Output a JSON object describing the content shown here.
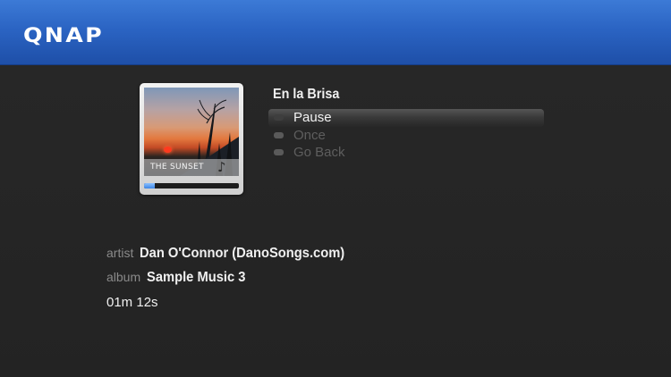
{
  "header": {
    "logo": "QNAP",
    "background_color": "#2b64c3"
  },
  "player": {
    "album_art": {
      "caption": "THE SUNSET",
      "icon": "music-note-icon",
      "progress_fraction": 0.11
    },
    "track_title": "En la Brisa",
    "menu": {
      "items": [
        {
          "label": "Pause",
          "selected": true
        },
        {
          "label": "Once",
          "selected": false
        },
        {
          "label": "Go Back",
          "selected": false
        }
      ]
    },
    "details": {
      "artist_label": "artist",
      "artist": "Dan O'Connor (DanoSongs.com)",
      "album_label": "album",
      "album": "Sample Music 3",
      "duration": "01m 12s"
    }
  },
  "colors": {
    "accent": "#3d86e6",
    "background": "#262626"
  }
}
